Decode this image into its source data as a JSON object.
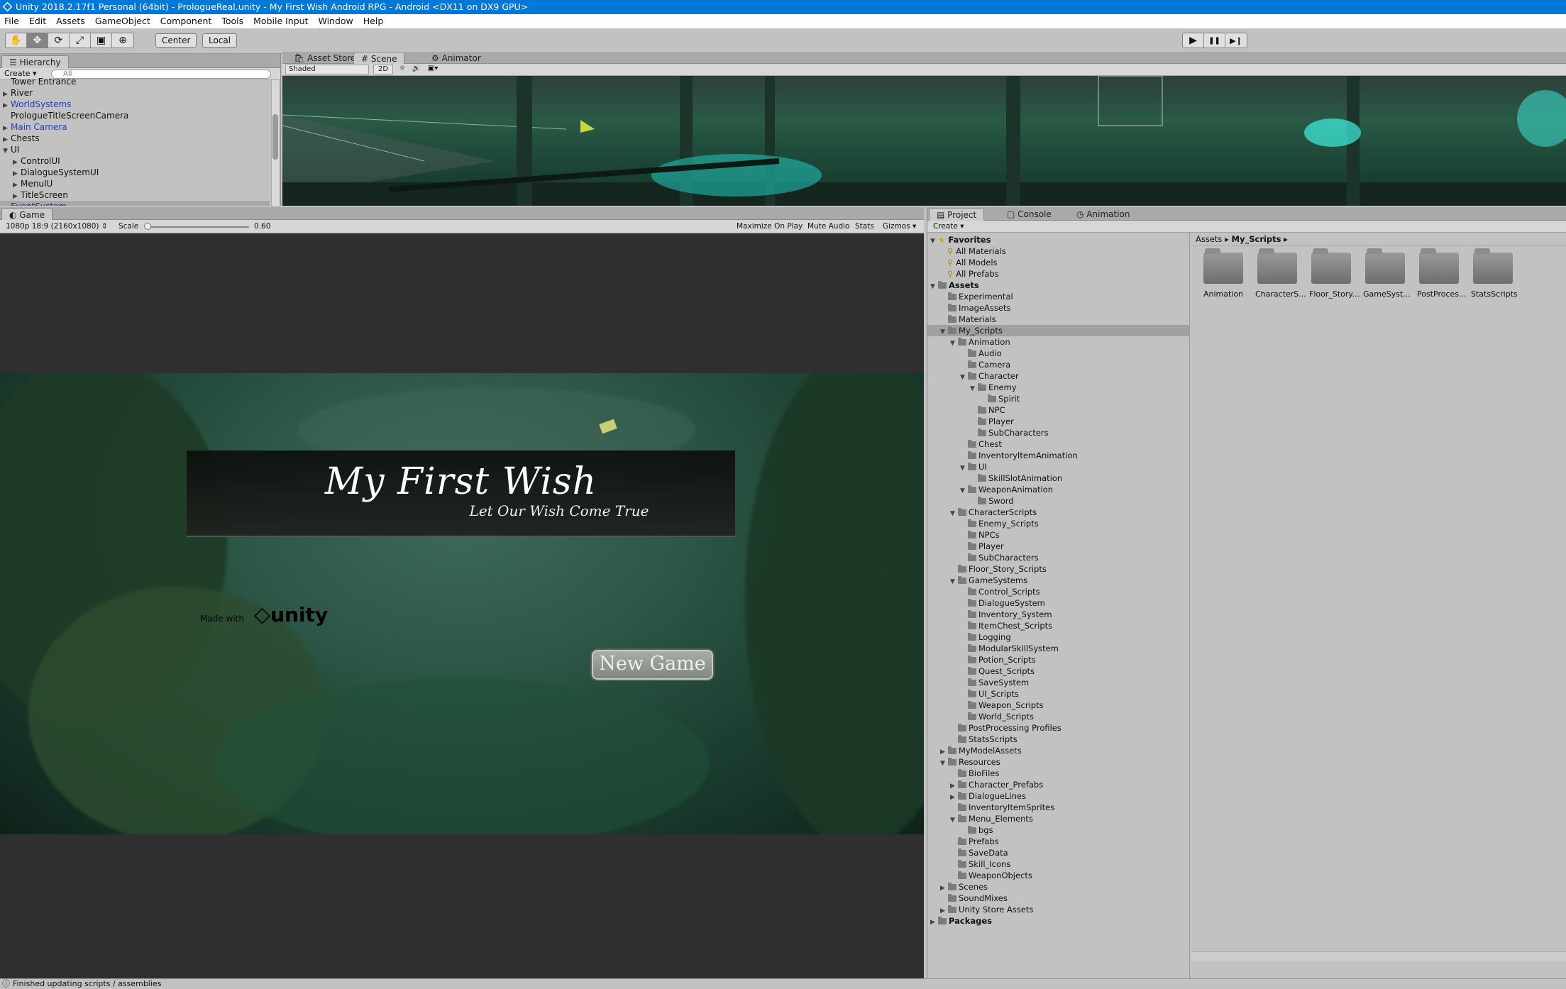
{
  "titlebar": {
    "text": "Unity 2018.2.17f1 Personal (64bit) - PrologueReal.unity - My First Wish Android RPG - Android <DX11 on DX9 GPU>"
  },
  "menu": [
    "File",
    "Edit",
    "Assets",
    "GameObject",
    "Component",
    "Tools",
    "Mobile Input",
    "Window",
    "Help"
  ],
  "toolbar": {
    "tools": [
      "hand-icon",
      "move-icon",
      "rotate-icon",
      "scale-icon",
      "rect-icon",
      "transform-icon"
    ],
    "pivot": "Center",
    "space": "Local"
  },
  "playcontrols": {
    "play": "▶",
    "pause": "❚❚",
    "step": "▶❙"
  },
  "hierarchy": {
    "title": "Hierarchy",
    "create": "Create",
    "search_placeholder": "All",
    "items": [
      {
        "label": "Tower Entrance",
        "indent": 1,
        "arrow": "",
        "blue": false
      },
      {
        "label": "River",
        "indent": 1,
        "arrow": "▶",
        "blue": false
      },
      {
        "label": "WorldSystems",
        "indent": 1,
        "arrow": "▶",
        "blue": true
      },
      {
        "label": "PrologueTitleScreenCamera",
        "indent": 1,
        "arrow": "",
        "blue": false
      },
      {
        "label": "Main Camera",
        "indent": 1,
        "arrow": "▶",
        "blue": true
      },
      {
        "label": "Chests",
        "indent": 1,
        "arrow": "▶",
        "blue": false
      },
      {
        "label": "UI",
        "indent": 1,
        "arrow": "▼",
        "blue": false
      },
      {
        "label": "ControlUI",
        "indent": 2,
        "arrow": "▶",
        "blue": false
      },
      {
        "label": "DialogueSystemUI",
        "indent": 2,
        "arrow": "▶",
        "blue": false
      },
      {
        "label": "MenuIU",
        "indent": 2,
        "arrow": "▶",
        "blue": false
      },
      {
        "label": "TitleScreen",
        "indent": 2,
        "arrow": "▶",
        "blue": false
      },
      {
        "label": "EventSystem",
        "indent": 1,
        "arrow": "",
        "blue": false,
        "selected": true
      }
    ]
  },
  "scene_tabs": [
    "Asset Store",
    "Scene",
    "Animator"
  ],
  "scene_toolbar": {
    "shading": "Shaded",
    "mode2d": "2D"
  },
  "game": {
    "tab": "Game",
    "resolution": "1080p 18:9 (2160x1080)",
    "scale_label": "Scale",
    "scale_value": "0.60",
    "buttons": [
      "Maximize On Play",
      "Mute Audio",
      "Stats",
      "Gizmos"
    ],
    "title": "My First Wish",
    "subtitle": "Let Our Wish Come True",
    "new_game": "New Game",
    "made_with": "Made with",
    "unity_logo": "unity"
  },
  "project": {
    "tabs": [
      "Project",
      "Console",
      "Animation"
    ],
    "create": "Create",
    "breadcrumb": [
      "Assets",
      "My_Scripts"
    ],
    "favorites_label": "Favorites",
    "favorites": [
      "All Materials",
      "All Models",
      "All Prefabs"
    ],
    "tree": [
      {
        "label": "Assets",
        "indent": 0,
        "arrow": "▼",
        "bold": true
      },
      {
        "label": "Experimental",
        "indent": 1,
        "arrow": ""
      },
      {
        "label": "ImageAssets",
        "indent": 1,
        "arrow": ""
      },
      {
        "label": "Materials",
        "indent": 1,
        "arrow": ""
      },
      {
        "label": "My_Scripts",
        "indent": 1,
        "arrow": "▼",
        "selected": true
      },
      {
        "label": "Animation",
        "indent": 2,
        "arrow": "▼"
      },
      {
        "label": "Audio",
        "indent": 3,
        "arrow": ""
      },
      {
        "label": "Camera",
        "indent": 3,
        "arrow": ""
      },
      {
        "label": "Character",
        "indent": 3,
        "arrow": "▼"
      },
      {
        "label": "Enemy",
        "indent": 4,
        "arrow": "▼"
      },
      {
        "label": "Spirit",
        "indent": 5,
        "arrow": ""
      },
      {
        "label": "NPC",
        "indent": 4,
        "arrow": ""
      },
      {
        "label": "Player",
        "indent": 4,
        "arrow": ""
      },
      {
        "label": "SubCharacters",
        "indent": 4,
        "arrow": ""
      },
      {
        "label": "Chest",
        "indent": 3,
        "arrow": ""
      },
      {
        "label": "InventoryItemAnimation",
        "indent": 3,
        "arrow": ""
      },
      {
        "label": "UI",
        "indent": 3,
        "arrow": "▼"
      },
      {
        "label": "SkillSlotAnimation",
        "indent": 4,
        "arrow": ""
      },
      {
        "label": "WeaponAnimation",
        "indent": 3,
        "arrow": "▼"
      },
      {
        "label": "Sword",
        "indent": 4,
        "arrow": ""
      },
      {
        "label": "CharacterScripts",
        "indent": 2,
        "arrow": "▼"
      },
      {
        "label": "Enemy_Scripts",
        "indent": 3,
        "arrow": ""
      },
      {
        "label": "NPCs",
        "indent": 3,
        "arrow": ""
      },
      {
        "label": "Player",
        "indent": 3,
        "arrow": ""
      },
      {
        "label": "SubCharacters",
        "indent": 3,
        "arrow": ""
      },
      {
        "label": "Floor_Story_Scripts",
        "indent": 2,
        "arrow": ""
      },
      {
        "label": "GameSystems",
        "indent": 2,
        "arrow": "▼"
      },
      {
        "label": "Control_Scripts",
        "indent": 3,
        "arrow": ""
      },
      {
        "label": "DialogueSystem",
        "indent": 3,
        "arrow": ""
      },
      {
        "label": "Inventory_System",
        "indent": 3,
        "arrow": ""
      },
      {
        "label": "ItemChest_Scripts",
        "indent": 3,
        "arrow": ""
      },
      {
        "label": "Logging",
        "indent": 3,
        "arrow": ""
      },
      {
        "label": "ModularSkillSystem",
        "indent": 3,
        "arrow": ""
      },
      {
        "label": "Potion_Scripts",
        "indent": 3,
        "arrow": ""
      },
      {
        "label": "Quest_Scripts",
        "indent": 3,
        "arrow": ""
      },
      {
        "label": "SaveSystem",
        "indent": 3,
        "arrow": ""
      },
      {
        "label": "UI_Scripts",
        "indent": 3,
        "arrow": ""
      },
      {
        "label": "Weapon_Scripts",
        "indent": 3,
        "arrow": ""
      },
      {
        "label": "World_Scripts",
        "indent": 3,
        "arrow": ""
      },
      {
        "label": "PostProcessing Profiles",
        "indent": 2,
        "arrow": ""
      },
      {
        "label": "StatsScripts",
        "indent": 2,
        "arrow": ""
      },
      {
        "label": "MyModelAssets",
        "indent": 1,
        "arrow": "▶"
      },
      {
        "label": "Resources",
        "indent": 1,
        "arrow": "▼"
      },
      {
        "label": "BioFiles",
        "indent": 2,
        "arrow": ""
      },
      {
        "label": "Character_Prefabs",
        "indent": 2,
        "arrow": "▶"
      },
      {
        "label": "DialogueLines",
        "indent": 2,
        "arrow": "▶"
      },
      {
        "label": "InventoryItemSprites",
        "indent": 2,
        "arrow": ""
      },
      {
        "label": "Menu_Elements",
        "indent": 2,
        "arrow": "▼"
      },
      {
        "label": "bgs",
        "indent": 3,
        "arrow": ""
      },
      {
        "label": "Prefabs",
        "indent": 2,
        "arrow": ""
      },
      {
        "label": "SaveData",
        "indent": 2,
        "arrow": ""
      },
      {
        "label": "Skill_Icons",
        "indent": 2,
        "arrow": ""
      },
      {
        "label": "WeaponObjects",
        "indent": 2,
        "arrow": ""
      },
      {
        "label": "Scenes",
        "indent": 1,
        "arrow": "▶"
      },
      {
        "label": "SoundMixes",
        "indent": 1,
        "arrow": ""
      },
      {
        "label": "Unity Store Assets",
        "indent": 1,
        "arrow": "▶"
      },
      {
        "label": "Packages",
        "indent": 0,
        "arrow": "▶",
        "bold": true
      }
    ],
    "grid_items": [
      "Animation",
      "CharacterS...",
      "Floor_Story...",
      "GameSyst...",
      "PostProces...",
      "StatsScripts"
    ]
  },
  "status": "Finished updating scripts / assemblies"
}
